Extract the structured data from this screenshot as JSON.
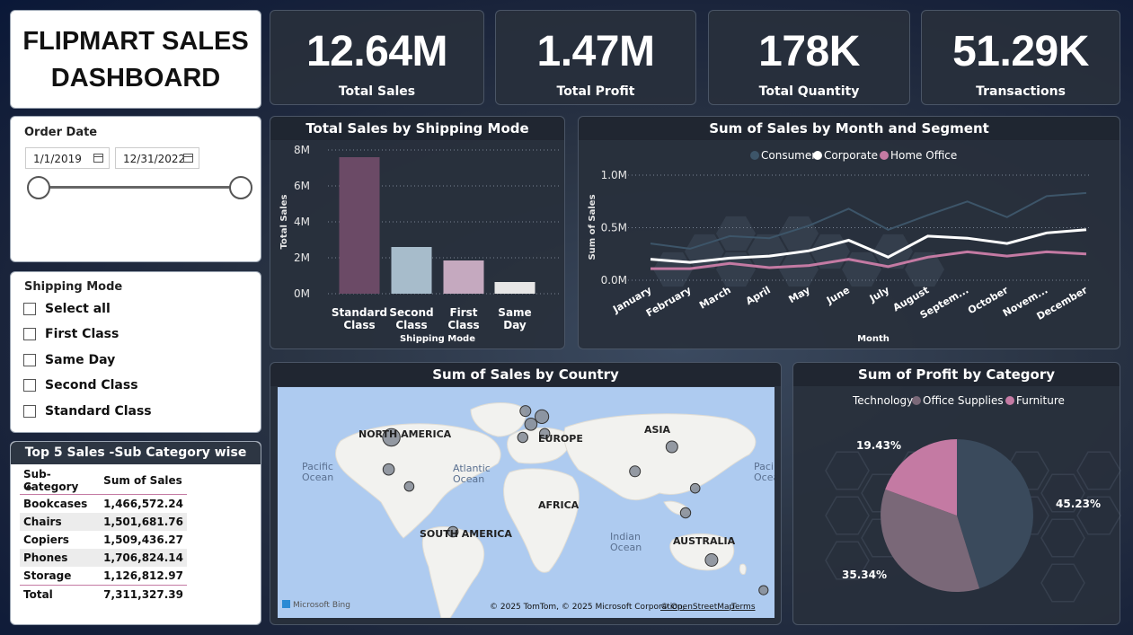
{
  "dashboard": {
    "title_line1": "FLIPMART SALES",
    "title_line2": "DASHBOARD"
  },
  "kpis": [
    {
      "value": "12.64M",
      "label": "Total Sales"
    },
    {
      "value": "1.47M",
      "label": "Total Profit"
    },
    {
      "value": "178K",
      "label": "Total Quantity"
    },
    {
      "value": "51.29K",
      "label": "Transactions"
    }
  ],
  "order_date": {
    "label": "Order Date",
    "start": "1/1/2019",
    "end": "12/31/2022"
  },
  "shipping_filter": {
    "label": "Shipping Mode",
    "options": [
      "Select all",
      "First Class",
      "Same Day",
      "Second Class",
      "Standard Class"
    ]
  },
  "top5": {
    "title": "Top 5 Sales -Sub Category wise",
    "headers": [
      "Sub-Category",
      "Sum of Sales"
    ],
    "rows": [
      [
        "Bookcases",
        "1,466,572.24"
      ],
      [
        "Chairs",
        "1,501,681.76"
      ],
      [
        "Copiers",
        "1,509,436.27"
      ],
      [
        "Phones",
        "1,706,824.14"
      ],
      [
        "Storage",
        "1,126,812.97"
      ]
    ],
    "total_label": "Total",
    "total_value": "7,311,327.39"
  },
  "map": {
    "title": "Sum of Sales by Country",
    "labels": [
      "NORTH AMERICA",
      "EUROPE",
      "ASIA",
      "AFRICA",
      "SOUTH AMERICA",
      "AUSTRALIA",
      "Pacific Ocean",
      "Atlantic Ocean",
      "Indian Ocean",
      "Paci Ocea"
    ],
    "attribution": "© 2025 TomTom, © 2025 Microsoft Corporation,",
    "osm": "© OpenStreetMap",
    "terms": "Terms",
    "brand": "Microsoft Bing"
  },
  "colors": {
    "consumer": "#3d5569",
    "corporate": "#ffffff",
    "home_office": "#c47aa3",
    "accent": "#c47aa3"
  },
  "chart_data": [
    {
      "type": "bar",
      "title": "Total Sales by Shipping Mode",
      "categories": [
        "Standard Class",
        "Second Class",
        "First Class",
        "Same Day"
      ],
      "category_lines": [
        [
          "Standard",
          "Class"
        ],
        [
          "Second",
          "Class"
        ],
        [
          "First",
          "Class"
        ],
        [
          "Same",
          "Day"
        ]
      ],
      "values": [
        7.6,
        2.6,
        1.85,
        0.65
      ],
      "unit": "M",
      "colors": [
        "#6b4a66",
        "#a7bccb",
        "#c5a9bf",
        "#e6e6e6"
      ],
      "xlabel": "Shipping Mode",
      "ylabel": "Total Sales",
      "yticks": [
        "0M",
        "2M",
        "4M",
        "6M",
        "8M"
      ],
      "ylim": [
        0,
        8
      ]
    },
    {
      "type": "line",
      "title": "Sum of Sales by Month and Segment",
      "x": [
        "January",
        "February",
        "March",
        "April",
        "May",
        "June",
        "July",
        "August",
        "Septem...",
        "October",
        "Novem...",
        "December"
      ],
      "series": [
        {
          "name": "Consumer",
          "values": [
            0.35,
            0.3,
            0.42,
            0.4,
            0.52,
            0.68,
            0.48,
            0.62,
            0.75,
            0.6,
            0.8,
            0.83
          ]
        },
        {
          "name": "Corporate",
          "values": [
            0.2,
            0.17,
            0.21,
            0.23,
            0.28,
            0.38,
            0.22,
            0.42,
            0.4,
            0.35,
            0.45,
            0.48
          ]
        },
        {
          "name": "Home Office",
          "values": [
            0.11,
            0.11,
            0.16,
            0.12,
            0.14,
            0.2,
            0.13,
            0.22,
            0.27,
            0.23,
            0.27,
            0.25
          ]
        }
      ],
      "xlabel": "Month",
      "ylabel": "Sum of Sales",
      "yticks": [
        "0.0M",
        "0.5M",
        "1.0M"
      ],
      "ylim": [
        0,
        1.0
      ]
    },
    {
      "type": "pie",
      "title": "Sum of Profit by Category",
      "categories": [
        "Technology",
        "Office Supplies",
        "Furniture"
      ],
      "values": [
        45.23,
        35.34,
        19.43
      ],
      "labels": [
        "45.23%",
        "35.34%",
        "19.43%"
      ],
      "colors": [
        "#3a4a5c",
        "#7a6878",
        "#c47aa3"
      ],
      "legend": "top"
    },
    {
      "type": "scatter",
      "title": "Sum of Sales by Country",
      "points": [
        {
          "lon": -100,
          "lat": 40,
          "value": 5.0
        },
        {
          "lon": -102,
          "lat": 23,
          "value": 1.2
        },
        {
          "lon": -87,
          "lat": 14,
          "value": 0.6
        },
        {
          "lon": -55,
          "lat": -10,
          "value": 0.9
        },
        {
          "lon": -2,
          "lat": 54,
          "value": 1.0
        },
        {
          "lon": 10,
          "lat": 51,
          "value": 2.4
        },
        {
          "lon": 2,
          "lat": 47,
          "value": 1.6
        },
        {
          "lon": -4,
          "lat": 40,
          "value": 0.8
        },
        {
          "lon": 12,
          "lat": 42,
          "value": 0.8
        },
        {
          "lon": 78,
          "lat": 22,
          "value": 1.0
        },
        {
          "lon": 105,
          "lat": 35,
          "value": 1.4
        },
        {
          "lon": 122,
          "lat": 13,
          "value": 0.6
        },
        {
          "lon": 115,
          "lat": 0,
          "value": 0.8
        },
        {
          "lon": 134,
          "lat": -25,
          "value": 1.8
        },
        {
          "lon": 172,
          "lat": -41,
          "value": 0.5
        }
      ]
    }
  ]
}
